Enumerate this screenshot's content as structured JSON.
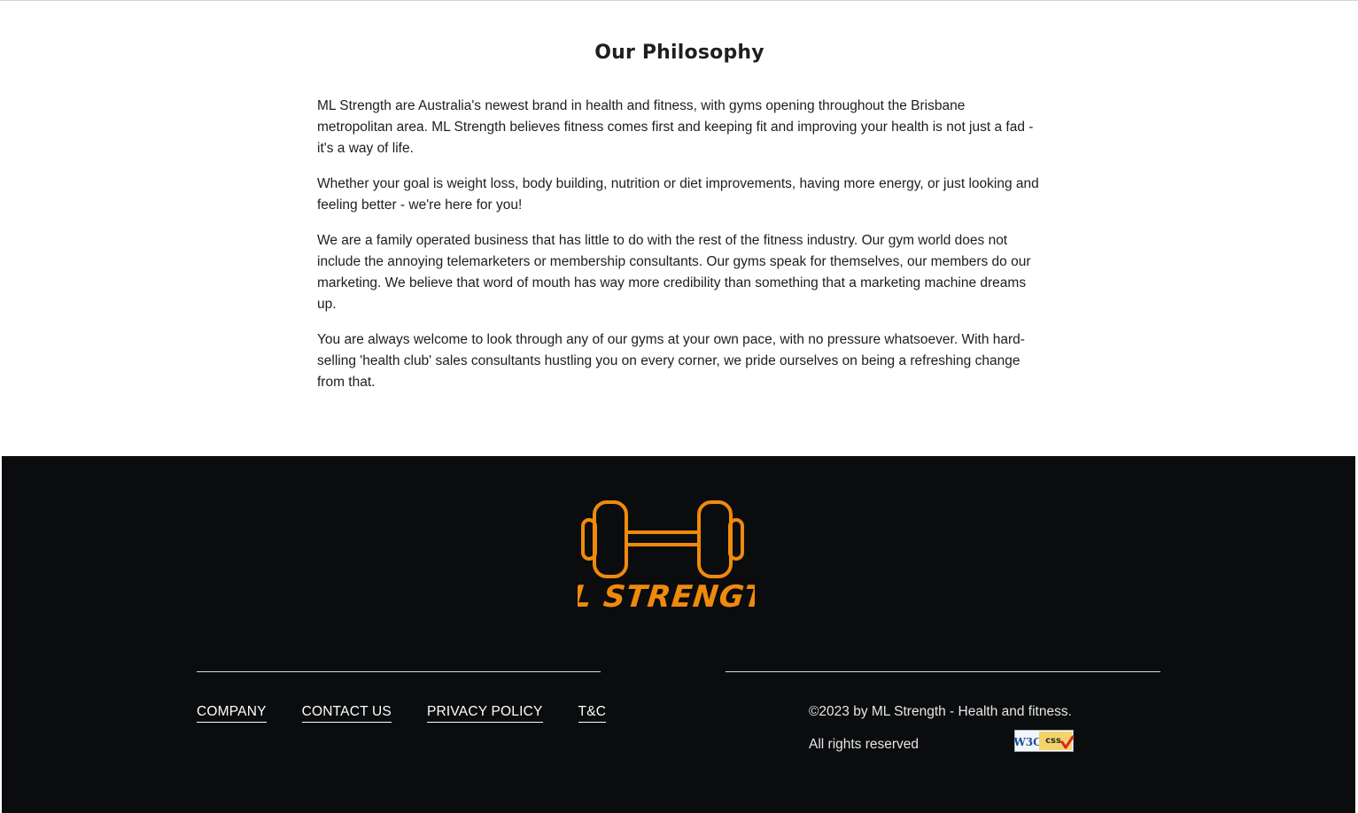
{
  "philosophy": {
    "title": "Our Philosophy",
    "paragraphs": [
      "ML Strength are Australia's newest brand in health and fitness, with gyms opening throughout the Brisbane metropolitan area. ML Strength believes fitness comes first and keeping fit and improving your health is not just a fad - it's a way of life.",
      "Whether your goal is weight loss, body building, nutrition or diet improvements, having more energy, or just looking and feeling better - we're here for you!",
      "We are a family operated business that has little to do with the rest of the fitness industry. Our gym world does not include the annoying telemarketers or membership consultants. Our gyms speak for themselves, our members do our marketing. We believe that word of mouth has way more credibility than something that a marketing machine dreams up.",
      "You are always welcome to look through any of our gyms at your own pace, with no pressure whatsoever. With hard-selling 'health club' sales consultants hustling you on every corner, we pride ourselves on being a refreshing change from that."
    ]
  },
  "footer": {
    "logo_text": "ML STRENGTH",
    "logo_icon": "dumbbell-icon",
    "logo_color": "#f08a0c",
    "background": "#0b0c0e",
    "nav": [
      {
        "label": "COMPANY"
      },
      {
        "label": "CONTACT US"
      },
      {
        "label": "PRIVACY POLICY"
      },
      {
        "label": "T&C"
      }
    ],
    "copyright": "©2023 by ML Strength - Health and fitness.",
    "rights": "All rights reserved",
    "badge": {
      "icon": "w3c-css-valid-badge",
      "w3c_text": "W3C",
      "css_text": "css"
    }
  }
}
